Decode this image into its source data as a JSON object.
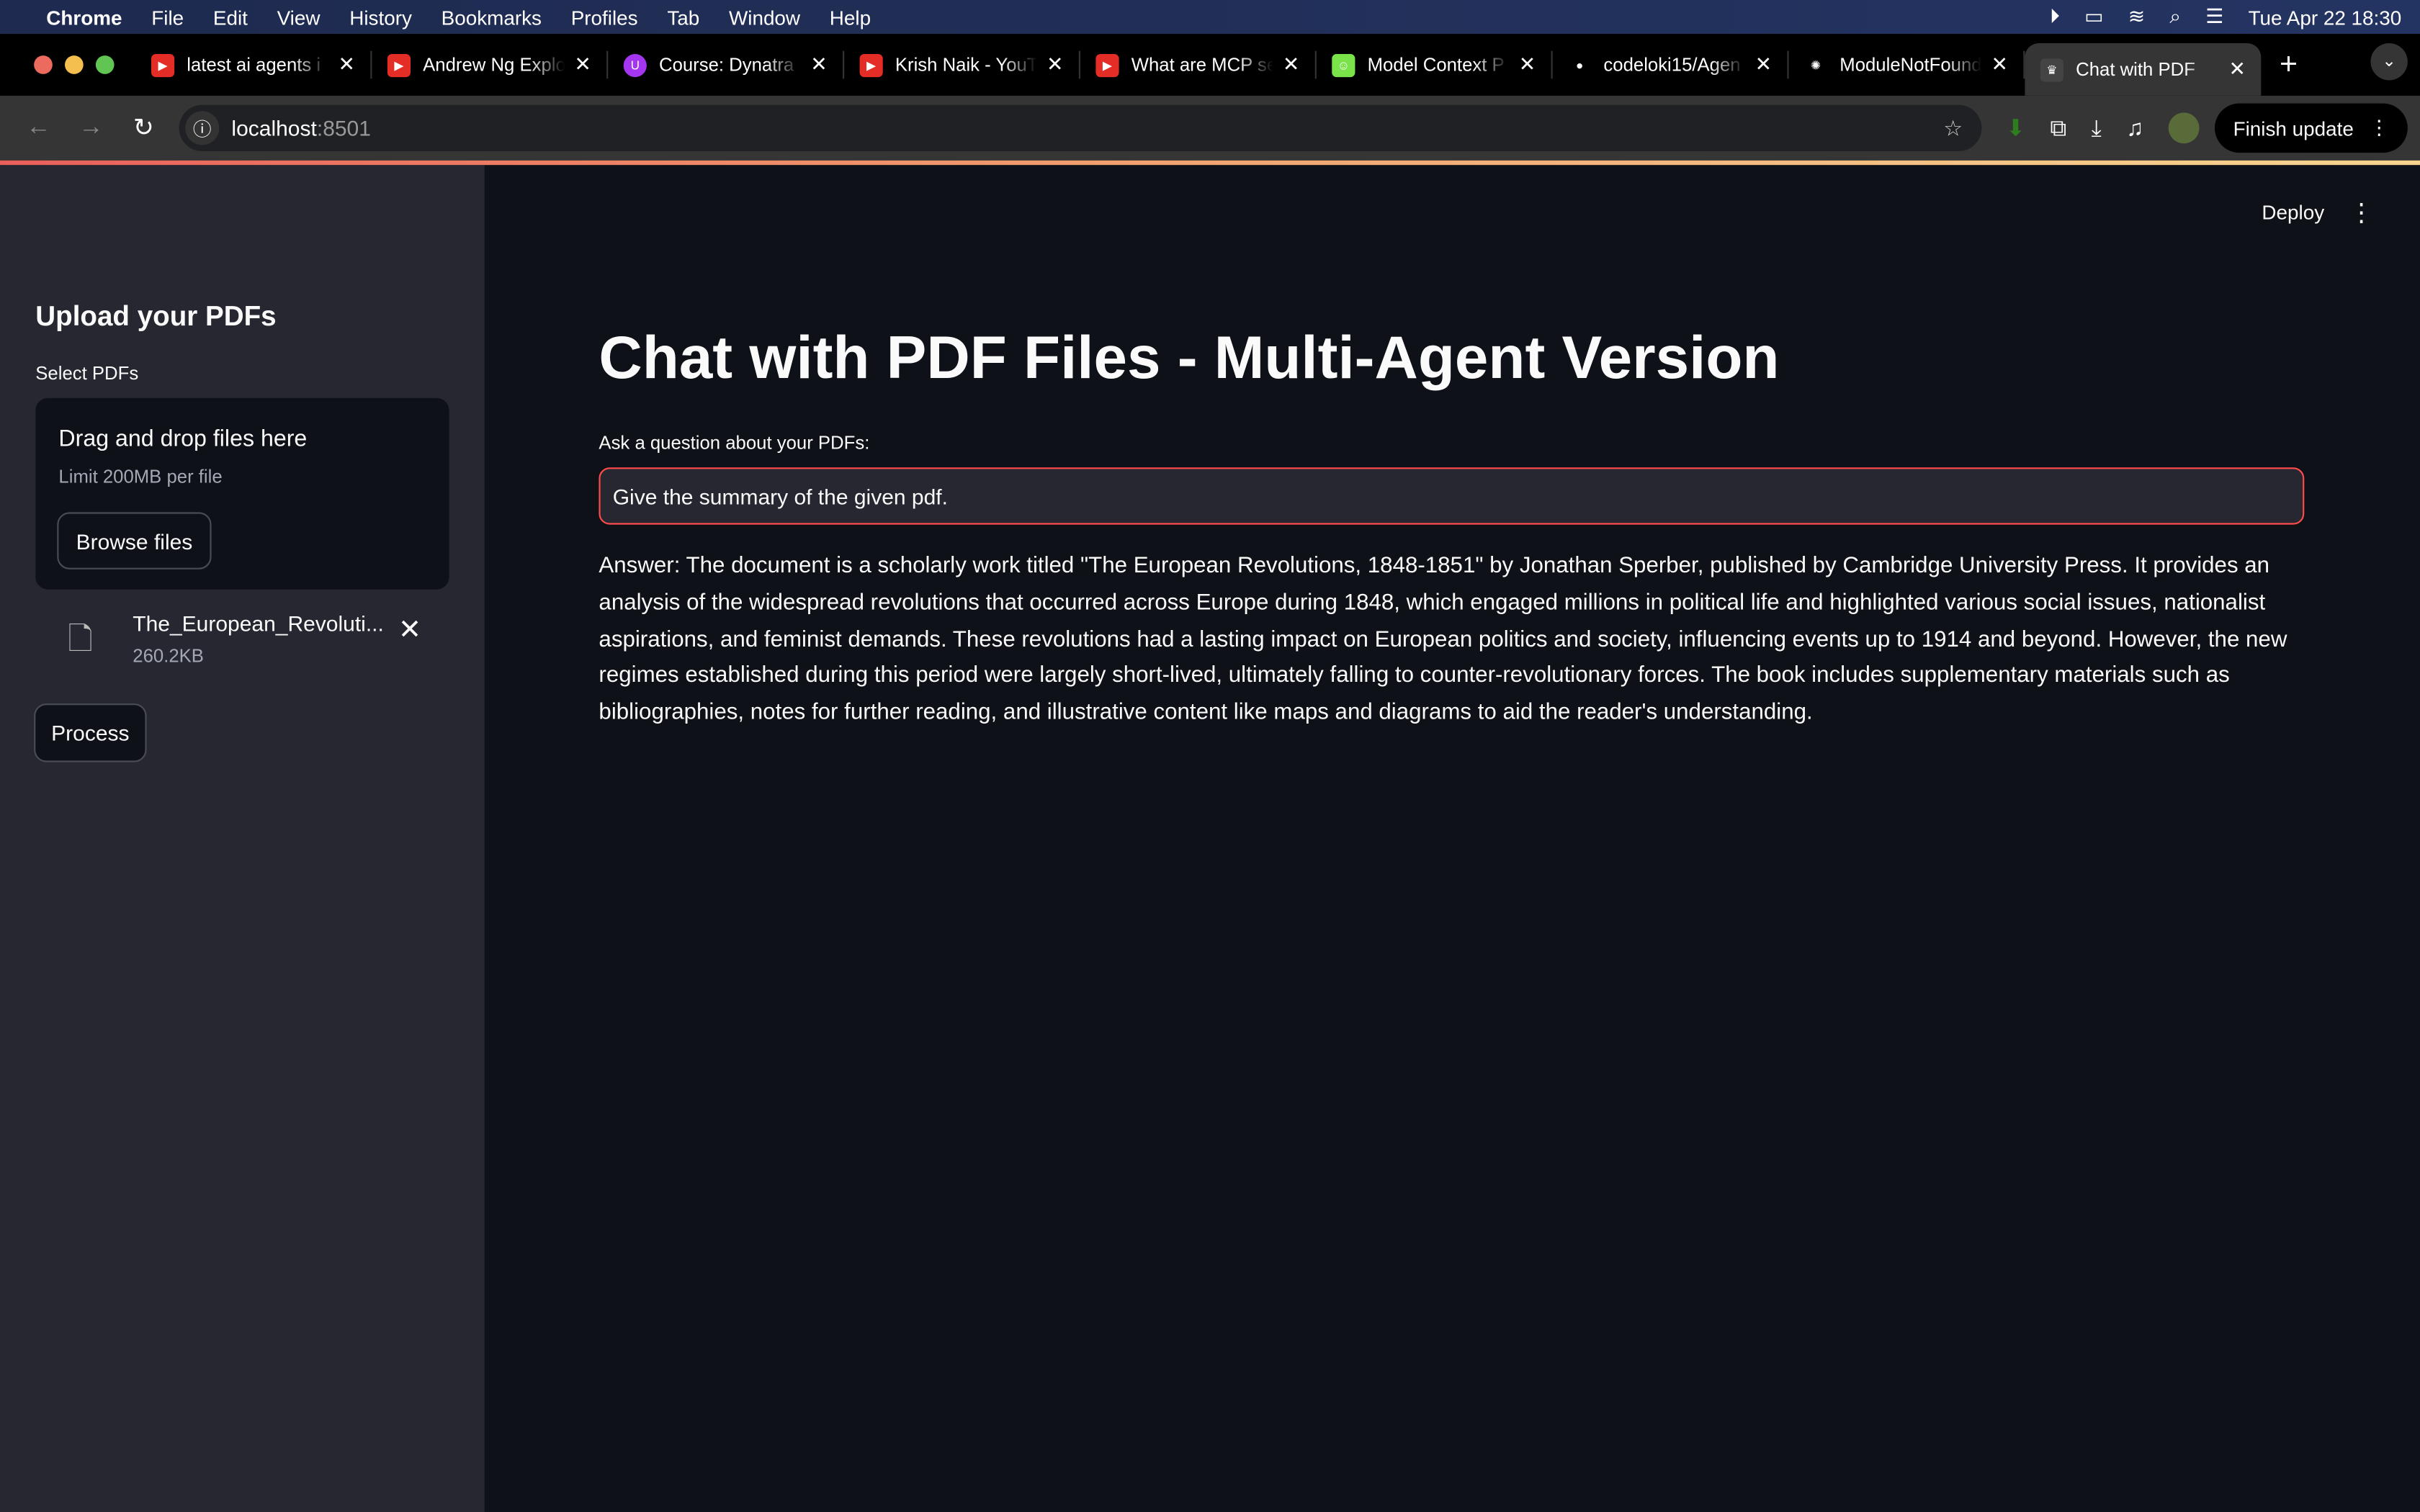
{
  "menubar": {
    "app": "Chrome",
    "items": [
      "File",
      "Edit",
      "View",
      "History",
      "Bookmarks",
      "Profiles",
      "Tab",
      "Window",
      "Help"
    ],
    "clock": "Tue Apr 22  18:30"
  },
  "tabs": [
    {
      "title": "latest ai agents i",
      "icon": "youtube-icon",
      "color": "#e52d27"
    },
    {
      "title": "Andrew Ng Explo",
      "icon": "youtube-icon",
      "color": "#e52d27"
    },
    {
      "title": "Course: Dynatra",
      "icon": "udemy-icon",
      "color": "#a435f0"
    },
    {
      "title": "Krish Naik - YouT",
      "icon": "youtube-icon",
      "color": "#e52d27"
    },
    {
      "title": "What are MCP se",
      "icon": "youtube-icon",
      "color": "#e52d27"
    },
    {
      "title": "Model Context P",
      "icon": "smiley-icon",
      "color": "#7be34a"
    },
    {
      "title": "codeloki15/Agen",
      "icon": "github-icon",
      "color": "#000000"
    },
    {
      "title": "ModuleNotFound",
      "icon": "openai-icon",
      "color": "#000000"
    },
    {
      "title": "Chat with PDF",
      "icon": "streamlit-icon",
      "color": "#444444"
    }
  ],
  "address": {
    "host": "localhost",
    "port": ":8501"
  },
  "toolbar": {
    "finish_update": "Finish update"
  },
  "sidebar": {
    "heading": "Upload your PDFs",
    "select_label": "Select PDFs",
    "drop_title": "Drag and drop files here",
    "drop_limit": "Limit 200MB per file",
    "browse": "Browse files",
    "file_name": "The_European_Revoluti...",
    "file_size": "260.2KB",
    "process": "Process"
  },
  "main": {
    "deploy": "Deploy",
    "title": "Chat with PDF Files - Multi-Agent Version",
    "question_label": "Ask a question about your PDFs:",
    "question_value": "Give the summary of the given pdf.",
    "answer": "Answer: The document is a scholarly work titled \"The European Revolutions, 1848-1851\" by Jonathan Sperber, published by Cambridge University Press. It provides an analysis of the widespread revolutions that occurred across Europe during 1848, which engaged millions in political life and highlighted various social issues, nationalist aspirations, and feminist demands. These revolutions had a lasting impact on European politics and society, influencing events up to 1914 and beyond. However, the new regimes established during this period were largely short-lived, ultimately falling to counter-revolutionary forces. The book includes supplementary materials such as bibliographies, notes for further reading, and illustrative content like maps and diagrams to aid the reader's understanding."
  }
}
